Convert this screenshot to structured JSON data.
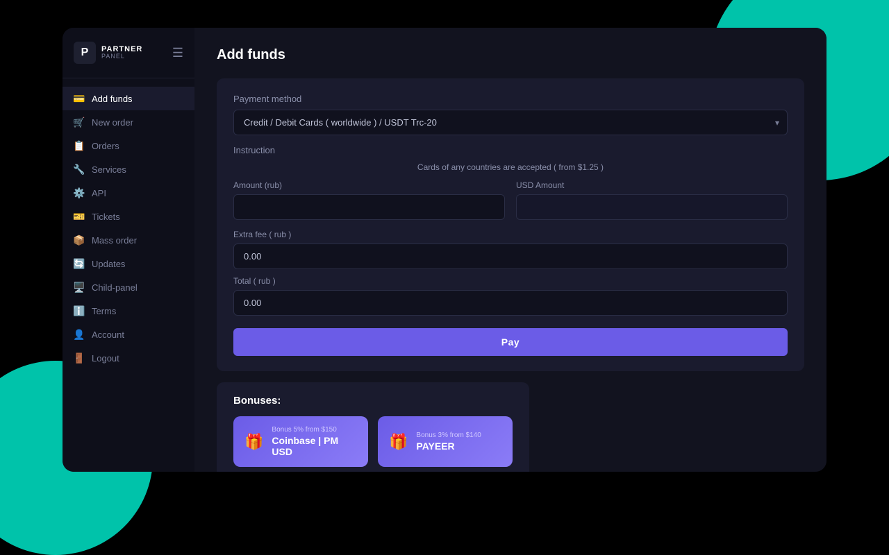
{
  "background": {
    "teal_color": "#00e5c8"
  },
  "logo": {
    "icon": "P",
    "title": "PARTNER",
    "subtitle": "PANEL"
  },
  "sidebar": {
    "items": [
      {
        "id": "add-funds",
        "label": "Add funds",
        "icon": "💳",
        "active": true
      },
      {
        "id": "new-order",
        "label": "New order",
        "icon": "🛒"
      },
      {
        "id": "orders",
        "label": "Orders",
        "icon": "📋"
      },
      {
        "id": "services",
        "label": "Services",
        "icon": "🔧"
      },
      {
        "id": "api",
        "label": "API",
        "icon": "⚙️"
      },
      {
        "id": "tickets",
        "label": "Tickets",
        "icon": "🎫"
      },
      {
        "id": "mass-order",
        "label": "Mass order",
        "icon": "📦"
      },
      {
        "id": "updates",
        "label": "Updates",
        "icon": "🔄"
      },
      {
        "id": "child-panel",
        "label": "Child-panel",
        "icon": "🖥️"
      },
      {
        "id": "terms",
        "label": "Terms",
        "icon": "ℹ️"
      },
      {
        "id": "account",
        "label": "Account",
        "icon": "👤"
      },
      {
        "id": "logout",
        "label": "Logout",
        "icon": "🚪"
      }
    ]
  },
  "main": {
    "page_title": "Add funds",
    "payment_method_label": "Payment method",
    "payment_method_value": "Credit / Debit Cards ( worldwide ) / USDT Trc-20",
    "instruction_label": "Instruction",
    "instruction_text": "Cards of any countries are accepted ( from $1.25 )",
    "amount_rub_label": "Amount (rub)",
    "amount_rub_placeholder": "",
    "usd_amount_label": "USD Amount",
    "usd_amount_placeholder": "",
    "extra_fee_label": "Extra fee ( rub )",
    "extra_fee_value": "0.00",
    "total_label": "Total ( rub )",
    "total_value": "0.00",
    "pay_button_label": "Pay"
  },
  "bonuses": {
    "title": "Bonuses:",
    "cards": [
      {
        "tag": "Bonus 5% from $150",
        "name": "Coinbase | PM USD",
        "icon": "🎁"
      },
      {
        "tag": "Bonus 3% from $140",
        "name": "PAYEER",
        "icon": "🎁"
      }
    ]
  }
}
